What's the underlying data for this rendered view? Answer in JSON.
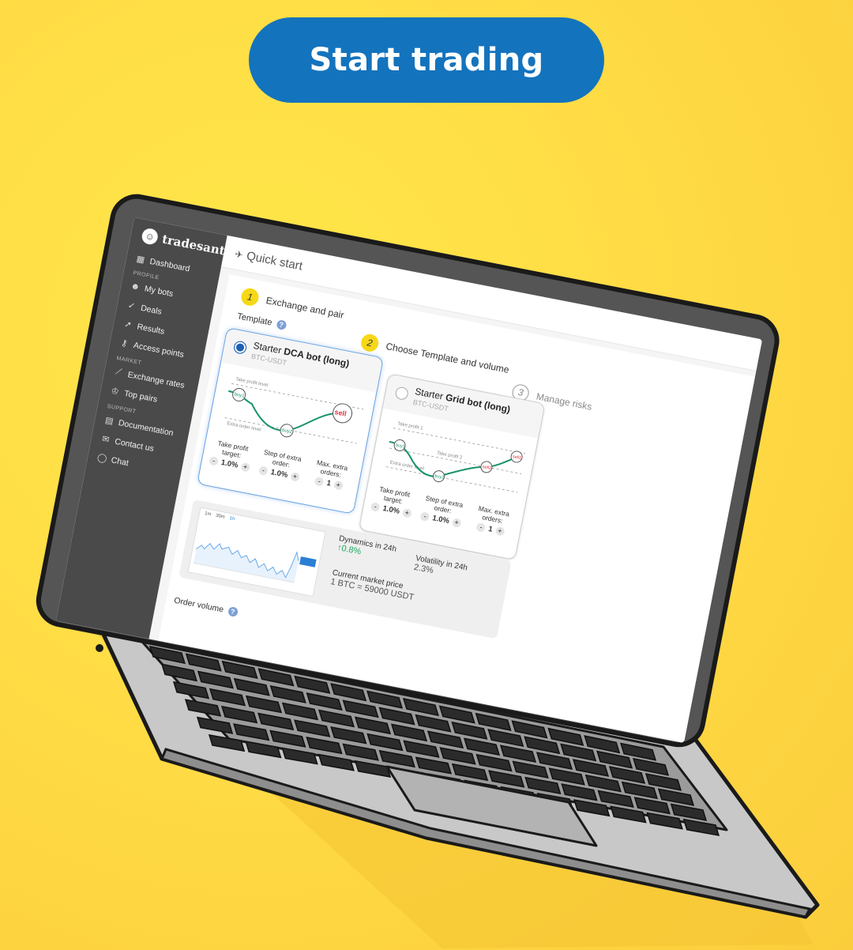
{
  "cta": {
    "label": "Start trading"
  },
  "colors": {
    "background": "#ffdc45",
    "cta": "#1473bd",
    "sidebar": "#4a4a4a",
    "step": "#f7d818",
    "accent_green": "#20a960",
    "sell_red": "#e0323c"
  },
  "sidebar": {
    "brand": "tradesanta",
    "dashboard": "Dashboard",
    "profile_section": "PROFILE",
    "my_bots": "My bots",
    "deals": "Deals",
    "results": "Results",
    "access_points": "Access points",
    "market_section": "MARKET",
    "exchange_rates": "Exchange rates",
    "top_pairs": "Top pairs",
    "support_section": "SUPPORT",
    "documentation": "Documentation",
    "contact_us": "Contact us",
    "chat": "Chat"
  },
  "page": {
    "title": "Quick start"
  },
  "steps": [
    {
      "num": "1",
      "label": "Exchange and pair"
    },
    {
      "num": "2",
      "label": "Choose Template and volume"
    },
    {
      "num": "3",
      "label": "Manage risks"
    }
  ],
  "template": {
    "label": "Template",
    "help": "?",
    "cards": [
      {
        "prefix": "Starter",
        "name": "DCA bot (long)",
        "pair": "BTC-USDT",
        "chart_labels": {
          "top": "Take profit level",
          "bottom": "Extra order level",
          "buy1": "buy1",
          "buy2": "buy2",
          "sell": "sell"
        },
        "params": [
          {
            "label": "Take profit target:",
            "value": "1.0%"
          },
          {
            "label": "Step of extra order:",
            "value": "1.0%"
          },
          {
            "label": "Max. extra orders:",
            "value": "1"
          }
        ]
      },
      {
        "prefix": "Starter",
        "name": "Grid bot (long)",
        "pair": "BTC-USDT",
        "chart_labels": {
          "top": "Take profit 1",
          "mid": "Take profit 2",
          "bottom": "Extra order level",
          "buy1": "buy1",
          "buy2": "buy2",
          "sell1": "sell1",
          "sell2": "sell2"
        },
        "params": [
          {
            "label": "Take profit target:",
            "value": "1.0%"
          },
          {
            "label": "Step of extra order:",
            "value": "1.0%"
          },
          {
            "label": "Max. extra orders:",
            "value": "1"
          }
        ]
      }
    ],
    "minus": "-",
    "plus": "+"
  },
  "market": {
    "timeframes": [
      "1m",
      "30m",
      "1h"
    ],
    "dynamics_label": "Dynamics in 24h",
    "dynamics_value": "↑0.8%",
    "volatility_label": "Volatility in 24h",
    "volatility_value": "2.3%",
    "price_label": "Current market price",
    "price_value": "1 BTC = 59000 USDT"
  },
  "order": {
    "label": "Order volume",
    "help": "?"
  }
}
